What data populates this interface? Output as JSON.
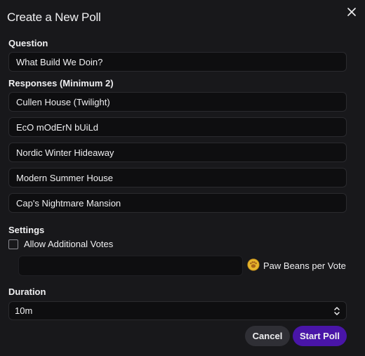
{
  "dialog": {
    "title": "Create a New Poll"
  },
  "question": {
    "label": "Question",
    "value": "What Build We Doin?"
  },
  "responses": {
    "label": "Responses (Minimum 2)",
    "items": [
      "Cullen House (Twilight)",
      "EcO mOdErN bUiLd",
      "Nordic Winter Hideaway",
      "Modern Summer House",
      "Cap's Nightmare Mansion"
    ]
  },
  "settings": {
    "label": "Settings",
    "allow_additional_votes_label": "Allow Additional Votes",
    "allow_additional_votes_checked": false,
    "beans_value": "",
    "beans_label": "Paw Beans per Vote",
    "beans_icon": "paw-bean-icon"
  },
  "duration": {
    "label": "Duration",
    "selected": "10m"
  },
  "buttons": {
    "cancel": "Cancel",
    "start": "Start Poll"
  },
  "colors": {
    "background": "#18181b",
    "input_background": "#0e0e10",
    "primary": "#4915a8",
    "secondary": "#2f2f35",
    "icon_accent": "#e7b52c"
  }
}
